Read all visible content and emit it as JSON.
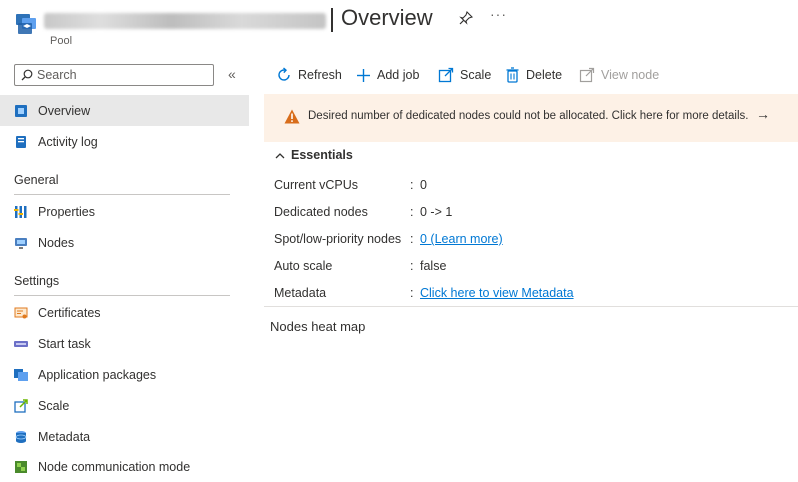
{
  "header": {
    "title": "Overview",
    "subtitle": "Pool",
    "pin_icon": "pin-icon",
    "more_label": "···"
  },
  "sidebar": {
    "search_placeholder": "Search",
    "collapse_label": "«",
    "items_top": [
      {
        "label": "Overview",
        "icon": "overview-icon",
        "active": true
      },
      {
        "label": "Activity log",
        "icon": "activity-log-icon"
      }
    ],
    "group_general": {
      "title": "General",
      "items": [
        {
          "label": "Properties",
          "icon": "properties-icon"
        },
        {
          "label": "Nodes",
          "icon": "nodes-icon"
        }
      ]
    },
    "group_settings": {
      "title": "Settings",
      "items": [
        {
          "label": "Certificates",
          "icon": "certificate-icon"
        },
        {
          "label": "Start task",
          "icon": "start-task-icon"
        },
        {
          "label": "Application packages",
          "icon": "application-packages-icon"
        },
        {
          "label": "Scale",
          "icon": "scale-icon"
        },
        {
          "label": "Metadata",
          "icon": "metadata-icon"
        },
        {
          "label": "Node communication mode",
          "icon": "node-communication-icon"
        }
      ]
    }
  },
  "toolbar": {
    "refresh": "Refresh",
    "add_job": "Add job",
    "scale": "Scale",
    "delete": "Delete",
    "view_node": "View node"
  },
  "banner": {
    "message": "Desired number of dedicated nodes could not be allocated. Click here for more details.",
    "arrow": "→"
  },
  "essentials": {
    "title": "Essentials",
    "rows": [
      {
        "key": "Current vCPUs",
        "value": "0"
      },
      {
        "key": "Dedicated nodes",
        "value": "0 -> 1"
      },
      {
        "key": "Spot/low-priority nodes",
        "value": "0 (Learn more)",
        "link": true
      },
      {
        "key": "Auto scale",
        "value": "false"
      },
      {
        "key": "Metadata",
        "value": "Click here to view Metadata",
        "link": true
      }
    ]
  },
  "heatmap": {
    "title": "Nodes heat map"
  },
  "colors": {
    "accent": "#0078d4",
    "warning": "#d86d1b",
    "banner_bg": "#fdf1e6",
    "active_bg": "#e8e8e8"
  }
}
